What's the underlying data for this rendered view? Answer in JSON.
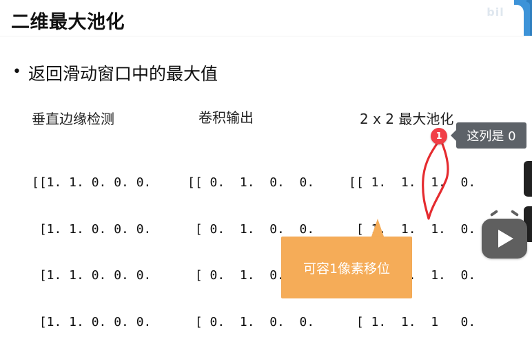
{
  "slide": {
    "title": "二维最大池化",
    "bullet_text": "返回滑动窗口中的最大值",
    "sections": [
      "垂直边缘检测",
      "卷积输出",
      "2 x 2 最大池化"
    ],
    "matrices": {
      "vertical_edge_detection": [
        "[[1. 1. 0. 0. 0.",
        " [1. 1. 0. 0. 0.",
        " [1. 1. 0. 0. 0.",
        " [1. 1. 0. 0. 0."
      ],
      "convolution_output": [
        "[[ 0.  1.  0.  0.",
        " [ 0.  1.  0.  0.",
        " [ 0.  1.  0.  0.",
        " [ 0.  1.  0.  0."
      ],
      "max_pooling_2x2": [
        "[[ 1.  1.  1.  0.",
        " [ 1.  1.  1.  0.",
        " [ 1.  1.  1.  0.",
        " [ 1.  1.  1   0."
      ]
    }
  },
  "annotation": {
    "badge": "1",
    "tooltip": "这列是 0",
    "orange_note": "可容1像素移位"
  },
  "logo": {
    "text": "bil",
    "colors": {
      "logo_text": "#dfe7ef",
      "curve": "#e52b2f",
      "note_bg": "#f5ac58",
      "tooltip_bg": "#5d6268"
    }
  },
  "icons": {
    "bullet": "bullet-dot",
    "play": "play-icon",
    "tv": "tv-icon"
  }
}
